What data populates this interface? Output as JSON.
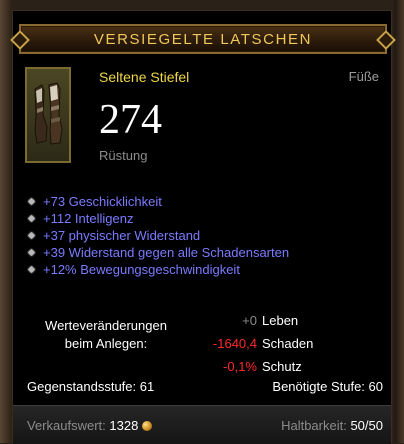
{
  "item": {
    "name": "VERSIEGELTE LATSCHEN",
    "rarity": "Seltene Stiefel",
    "slot": "Füße",
    "armor_value": "274",
    "armor_label": "Rüstung",
    "icon": "boots-icon"
  },
  "affixes": [
    "+73 Geschicklichkeit",
    "+112 Intelligenz",
    "+37 physischer Widerstand",
    "+39 Widerstand gegen alle Schadensarten",
    "+12% Bewegungsgeschwindigkeit"
  ],
  "comparison": {
    "label_line1": "Werteveränderungen",
    "label_line2": "beim Anlegen:",
    "rows": [
      {
        "value": "+0",
        "label": "Leben",
        "tone": "neutral"
      },
      {
        "value": "-1640,4",
        "label": "Schaden",
        "tone": "negative"
      },
      {
        "value": "-0,1%",
        "label": "Schutz",
        "tone": "negative"
      }
    ]
  },
  "levels": {
    "item_level": "Gegenstandsstufe: 61",
    "required_level": "Benötigte Stufe: 60"
  },
  "footer": {
    "sell_label": "Verkaufswert:",
    "sell_value": "1328",
    "durability_label": "Haltbarkeit:",
    "durability_value": "50/50",
    "currency_icon": "gold-coin-icon"
  },
  "colors": {
    "title_gold": "#f0c75a",
    "rare_yellow": "#f0d64a",
    "affix_blue": "#7b7bff",
    "negative_red": "#ff2a2a"
  }
}
